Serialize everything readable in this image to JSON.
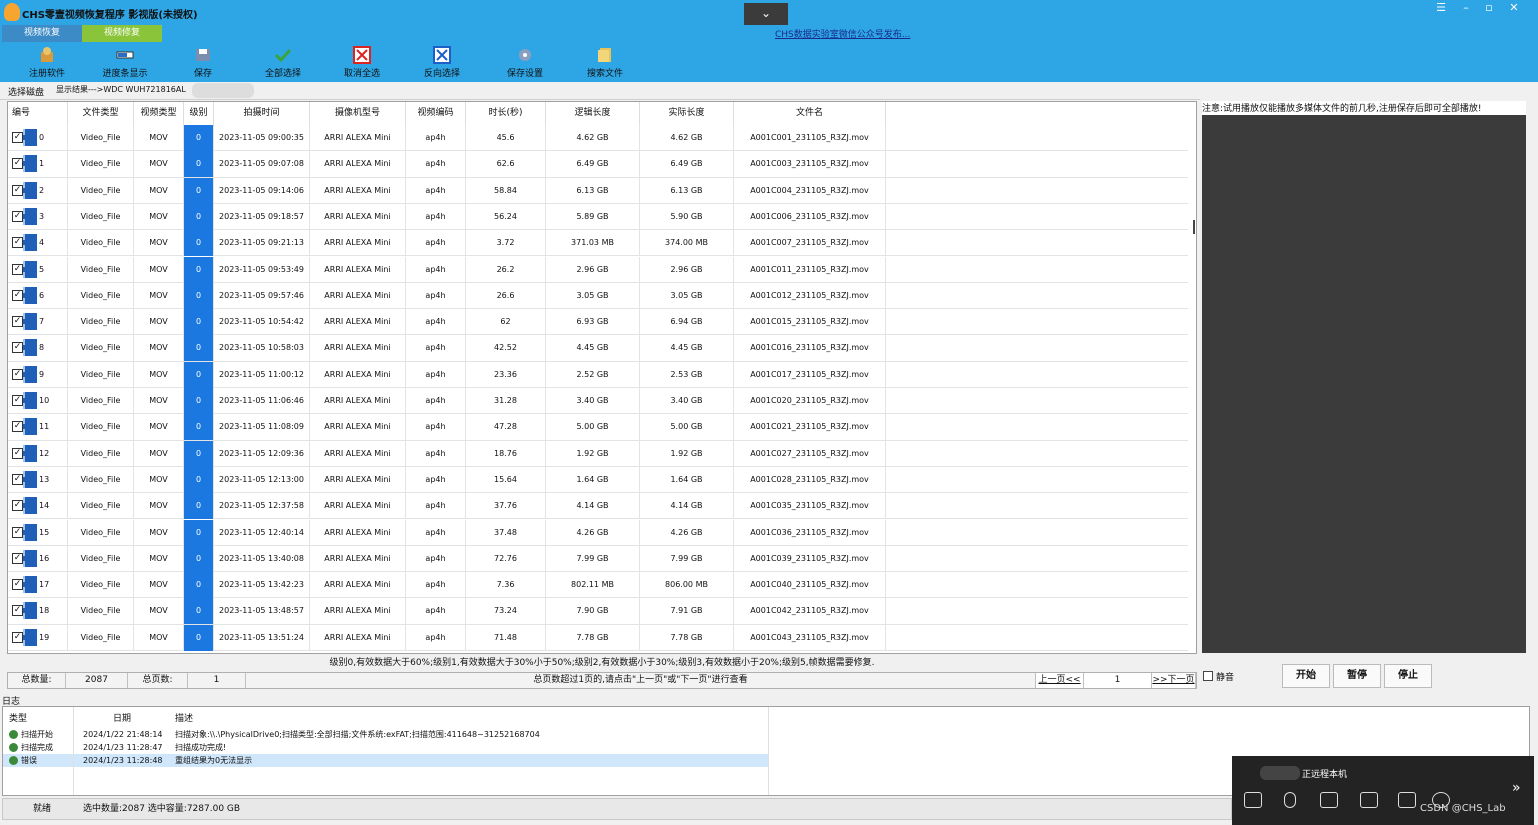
{
  "window": {
    "title": "CHS零壹视频恢复程序 影视版(未授权)",
    "collapse_icon": "chevron-down-icon"
  },
  "tabs": [
    {
      "label": "视频恢复"
    },
    {
      "label": "视频修复"
    }
  ],
  "notice_link": "CHS数据实验室微信公众号发布...",
  "toolbar": [
    {
      "label": "注册软件",
      "icon": "register-icon"
    },
    {
      "label": "进度条显示",
      "icon": "progress-icon"
    },
    {
      "label": "保存",
      "icon": "save-icon"
    },
    {
      "label": "全部选择",
      "icon": "check-all-icon"
    },
    {
      "label": "取消全选",
      "icon": "uncheck-icon"
    },
    {
      "label": "反向选择",
      "icon": "invert-icon"
    },
    {
      "label": "保存设置",
      "icon": "settings-icon"
    },
    {
      "label": "搜索文件",
      "icon": "search-file-icon"
    }
  ],
  "address": {
    "select_disk": "选择磁盘",
    "result_path": "显示结果--->WDC WUH721816AL"
  },
  "table": {
    "columns": [
      "编号",
      "文件类型",
      "视频类型",
      "级别",
      "拍摄时间",
      "摄像机型号",
      "视频编码",
      "时长(秒)",
      "逻辑长度",
      "实际长度",
      "文件名"
    ],
    "rows": [
      [
        "0",
        "Video_File",
        "MOV",
        "0",
        "2023-11-05 09:00:35",
        "ARRI ALEXA Mini",
        "ap4h",
        "45.6",
        "4.62 GB",
        "4.62 GB",
        "A001C001_231105_R3ZJ.mov"
      ],
      [
        "1",
        "Video_File",
        "MOV",
        "0",
        "2023-11-05 09:07:08",
        "ARRI ALEXA Mini",
        "ap4h",
        "62.6",
        "6.49 GB",
        "6.49 GB",
        "A001C003_231105_R3ZJ.mov"
      ],
      [
        "2",
        "Video_File",
        "MOV",
        "0",
        "2023-11-05 09:14:06",
        "ARRI ALEXA Mini",
        "ap4h",
        "58.84",
        "6.13 GB",
        "6.13 GB",
        "A001C004_231105_R3ZJ.mov"
      ],
      [
        "3",
        "Video_File",
        "MOV",
        "0",
        "2023-11-05 09:18:57",
        "ARRI ALEXA Mini",
        "ap4h",
        "56.24",
        "5.89 GB",
        "5.90 GB",
        "A001C006_231105_R3ZJ.mov"
      ],
      [
        "4",
        "Video_File",
        "MOV",
        "0",
        "2023-11-05 09:21:13",
        "ARRI ALEXA Mini",
        "ap4h",
        "3.72",
        "371.03 MB",
        "374.00 MB",
        "A001C007_231105_R3ZJ.mov"
      ],
      [
        "5",
        "Video_File",
        "MOV",
        "0",
        "2023-11-05 09:53:49",
        "ARRI ALEXA Mini",
        "ap4h",
        "26.2",
        "2.96 GB",
        "2.96 GB",
        "A001C011_231105_R3ZJ.mov"
      ],
      [
        "6",
        "Video_File",
        "MOV",
        "0",
        "2023-11-05 09:57:46",
        "ARRI ALEXA Mini",
        "ap4h",
        "26.6",
        "3.05 GB",
        "3.05 GB",
        "A001C012_231105_R3ZJ.mov"
      ],
      [
        "7",
        "Video_File",
        "MOV",
        "0",
        "2023-11-05 10:54:42",
        "ARRI ALEXA Mini",
        "ap4h",
        "62",
        "6.93 GB",
        "6.94 GB",
        "A001C015_231105_R3ZJ.mov"
      ],
      [
        "8",
        "Video_File",
        "MOV",
        "0",
        "2023-11-05 10:58:03",
        "ARRI ALEXA Mini",
        "ap4h",
        "42.52",
        "4.45 GB",
        "4.45 GB",
        "A001C016_231105_R3ZJ.mov"
      ],
      [
        "9",
        "Video_File",
        "MOV",
        "0",
        "2023-11-05 11:00:12",
        "ARRI ALEXA Mini",
        "ap4h",
        "23.36",
        "2.52 GB",
        "2.53 GB",
        "A001C017_231105_R3ZJ.mov"
      ],
      [
        "10",
        "Video_File",
        "MOV",
        "0",
        "2023-11-05 11:06:46",
        "ARRI ALEXA Mini",
        "ap4h",
        "31.28",
        "3.40 GB",
        "3.40 GB",
        "A001C020_231105_R3ZJ.mov"
      ],
      [
        "11",
        "Video_File",
        "MOV",
        "0",
        "2023-11-05 11:08:09",
        "ARRI ALEXA Mini",
        "ap4h",
        "47.28",
        "5.00 GB",
        "5.00 GB",
        "A001C021_231105_R3ZJ.mov"
      ],
      [
        "12",
        "Video_File",
        "MOV",
        "0",
        "2023-11-05 12:09:36",
        "ARRI ALEXA Mini",
        "ap4h",
        "18.76",
        "1.92 GB",
        "1.92 GB",
        "A001C027_231105_R3ZJ.mov"
      ],
      [
        "13",
        "Video_File",
        "MOV",
        "0",
        "2023-11-05 12:13:00",
        "ARRI ALEXA Mini",
        "ap4h",
        "15.64",
        "1.64 GB",
        "1.64 GB",
        "A001C028_231105_R3ZJ.mov"
      ],
      [
        "14",
        "Video_File",
        "MOV",
        "0",
        "2023-11-05 12:37:58",
        "ARRI ALEXA Mini",
        "ap4h",
        "37.76",
        "4.14 GB",
        "4.14 GB",
        "A001C035_231105_R3ZJ.mov"
      ],
      [
        "15",
        "Video_File",
        "MOV",
        "0",
        "2023-11-05 12:40:14",
        "ARRI ALEXA Mini",
        "ap4h",
        "37.48",
        "4.26 GB",
        "4.26 GB",
        "A001C036_231105_R3ZJ.mov"
      ],
      [
        "16",
        "Video_File",
        "MOV",
        "0",
        "2023-11-05 13:40:08",
        "ARRI ALEXA Mini",
        "ap4h",
        "72.76",
        "7.99 GB",
        "7.99 GB",
        "A001C039_231105_R3ZJ.mov"
      ],
      [
        "17",
        "Video_File",
        "MOV",
        "0",
        "2023-11-05 13:42:23",
        "ARRI ALEXA Mini",
        "ap4h",
        "7.36",
        "802.11 MB",
        "806.00 MB",
        "A001C040_231105_R3ZJ.mov"
      ],
      [
        "18",
        "Video_File",
        "MOV",
        "0",
        "2023-11-05 13:48:57",
        "ARRI ALEXA Mini",
        "ap4h",
        "73.24",
        "7.90 GB",
        "7.91 GB",
        "A001C042_231105_R3ZJ.mov"
      ],
      [
        "19",
        "Video_File",
        "MOV",
        "0",
        "2023-11-05 13:51:24",
        "ARRI ALEXA Mini",
        "ap4h",
        "71.48",
        "7.78 GB",
        "7.78 GB",
        "A001C043_231105_R3ZJ.mov"
      ]
    ]
  },
  "legend": "级别0,有效数据大于60%;级别1,有效数据大于30%小于50%;级别2,有效数据小于30%;级别3,有效数据小于20%;级别5,帧数据需要修复.",
  "status": {
    "total_label": "总数量:",
    "total_value": "2087",
    "pages_label": "总页数:",
    "pages_value": "1",
    "hint": "总页数超过1页的,请点击\"上一页\"或\"下一页\"进行查看",
    "prev_label": "上一页<<",
    "page_input": "1",
    "next_label": ">>下一页"
  },
  "preview": {
    "note": "注意:试用播放仅能播放多媒体文件的前几秒,注册保存后即可全部播放!",
    "mute_label": "静音",
    "start_label": "开始",
    "pause_label": "暂停",
    "stop_label": "停止"
  },
  "log": {
    "title": "日志",
    "columns": [
      "类型",
      "日期",
      "描述"
    ],
    "rows": [
      {
        "type": "扫描开始",
        "date": "2024/1/22 21:48:14",
        "desc": "扫描对象:\\\\.\\PhysicalDrive0;扫描类型:全部扫描;文件系统:exFAT;扫描范围:411648~31252168704"
      },
      {
        "type": "扫描完成",
        "date": "2024/1/23 11:28:47",
        "desc": "扫描成功完成!"
      },
      {
        "type": "错误",
        "date": "2024/1/23 11:28:48",
        "desc": "重组结果为0无法显示"
      }
    ]
  },
  "bottom_status": {
    "ready": "就绪",
    "selection": "选中数量:2087 选中容量:7287.00 GB"
  },
  "remote": {
    "label": "正远程本机",
    "watermark": "CSDN @CHS_Lab"
  },
  "colors": {
    "titlebar": "#2ea6e6",
    "level_cell": "#1b78e0",
    "preview_bg": "#3b3b3b"
  }
}
